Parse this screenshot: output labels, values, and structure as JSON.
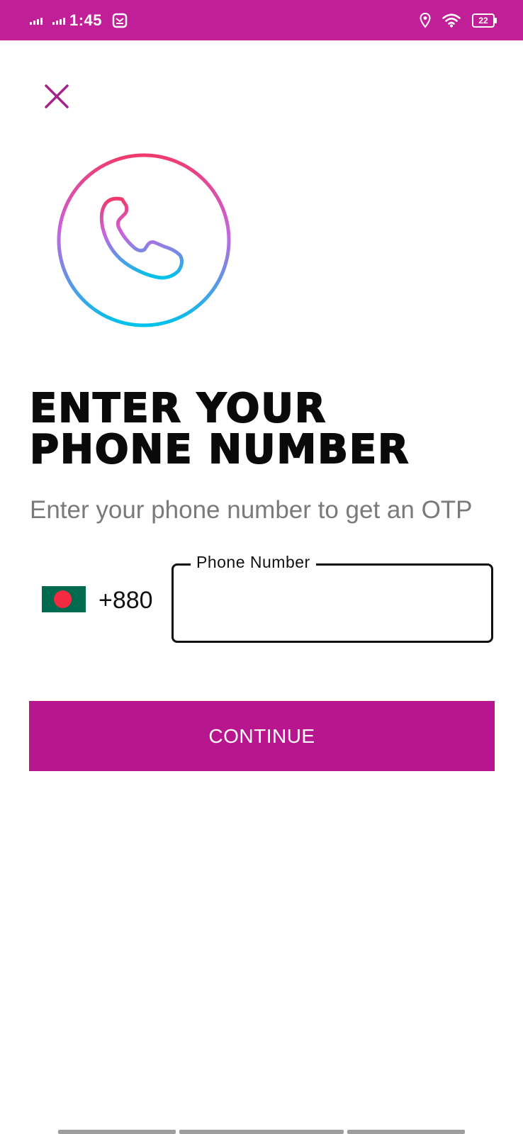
{
  "status_bar": {
    "time": "1:45",
    "battery_level": "22",
    "background_color": "#c01f97",
    "icons": [
      "signal-icon",
      "signal-icon",
      "mail-notification-icon",
      "location-icon",
      "wifi-icon",
      "battery-icon"
    ]
  },
  "header": {
    "close_icon": "close-icon",
    "close_color": "#a3238e"
  },
  "hero": {
    "icon": "phone-icon",
    "gradient_colors": [
      "#f03a6c",
      "#c764e0",
      "#00c2ea"
    ]
  },
  "content": {
    "title": "ENTER YOUR PHONE NUMBER",
    "subtitle": "Enter your phone number to get an OTP"
  },
  "phone_input": {
    "country_flag": "bangladesh-flag-icon",
    "country_code": "+880",
    "label": "Phone Number",
    "value": ""
  },
  "actions": {
    "continue_label": "CONTINUE",
    "continue_color": "#b8168f"
  }
}
